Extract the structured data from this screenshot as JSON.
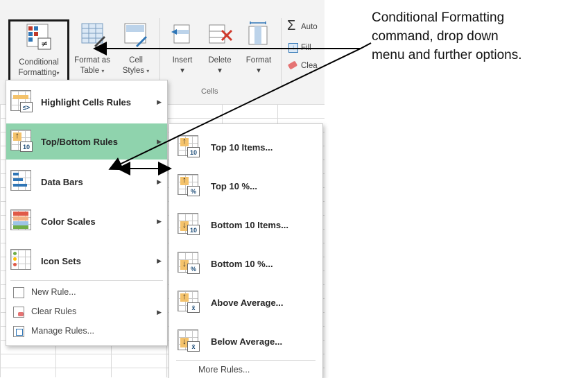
{
  "ribbon": {
    "conditional_formatting_line1": "Conditional",
    "conditional_formatting_line2": "Formatting",
    "format_as_table_line1": "Format as",
    "format_as_table_line2": "Table",
    "cell_styles_line1": "Cell",
    "cell_styles_line2": "Styles",
    "insert": "Insert",
    "delete": "Delete",
    "format": "Format",
    "autosum": "Auto",
    "fill": "Fill",
    "clear": "Clea",
    "cells_group": "Cells",
    "caret": "▾"
  },
  "main_menu": {
    "items": [
      {
        "label": "Highlight Cells Rules",
        "icon": "highlight-cells-icon",
        "has_submenu": true
      },
      {
        "label": "Top/Bottom Rules",
        "icon": "top-bottom-icon",
        "has_submenu": true,
        "active": true
      },
      {
        "label": "Data Bars",
        "icon": "data-bars-icon",
        "has_submenu": true
      },
      {
        "label": "Color Scales",
        "icon": "color-scales-icon",
        "has_submenu": true
      },
      {
        "label": "Icon Sets",
        "icon": "icon-sets-icon",
        "has_submenu": true
      }
    ],
    "commands": [
      {
        "label": "New Rule...",
        "icon": "new-rule-icon"
      },
      {
        "label": "Clear Rules",
        "icon": "clear-rules-icon",
        "has_submenu": true
      },
      {
        "label": "Manage Rules...",
        "icon": "manage-rules-icon"
      }
    ],
    "submenu_arrow": "▶"
  },
  "sub_menu": {
    "items": [
      {
        "label": "Top 10 Items...",
        "badge": "10"
      },
      {
        "label": "Top 10 %...",
        "badge": "%"
      },
      {
        "label": "Bottom 10 Items...",
        "badge": "10"
      },
      {
        "label": "Bottom 10 %...",
        "badge": "%"
      },
      {
        "label": "Above Average...",
        "badge": "x̄"
      },
      {
        "label": "Below Average...",
        "badge": "x̄"
      }
    ],
    "more_rules": "More Rules..."
  },
  "annotation": {
    "line1": "Conditional Formatting",
    "line2": "command, drop down",
    "line3": "menu and further options."
  },
  "colors": {
    "ribbon_bg": "#f3f3f3",
    "active_item": "#8fd3ad",
    "icon_fill": "#f4c26b",
    "highlight_border": "#1a1a1a"
  }
}
